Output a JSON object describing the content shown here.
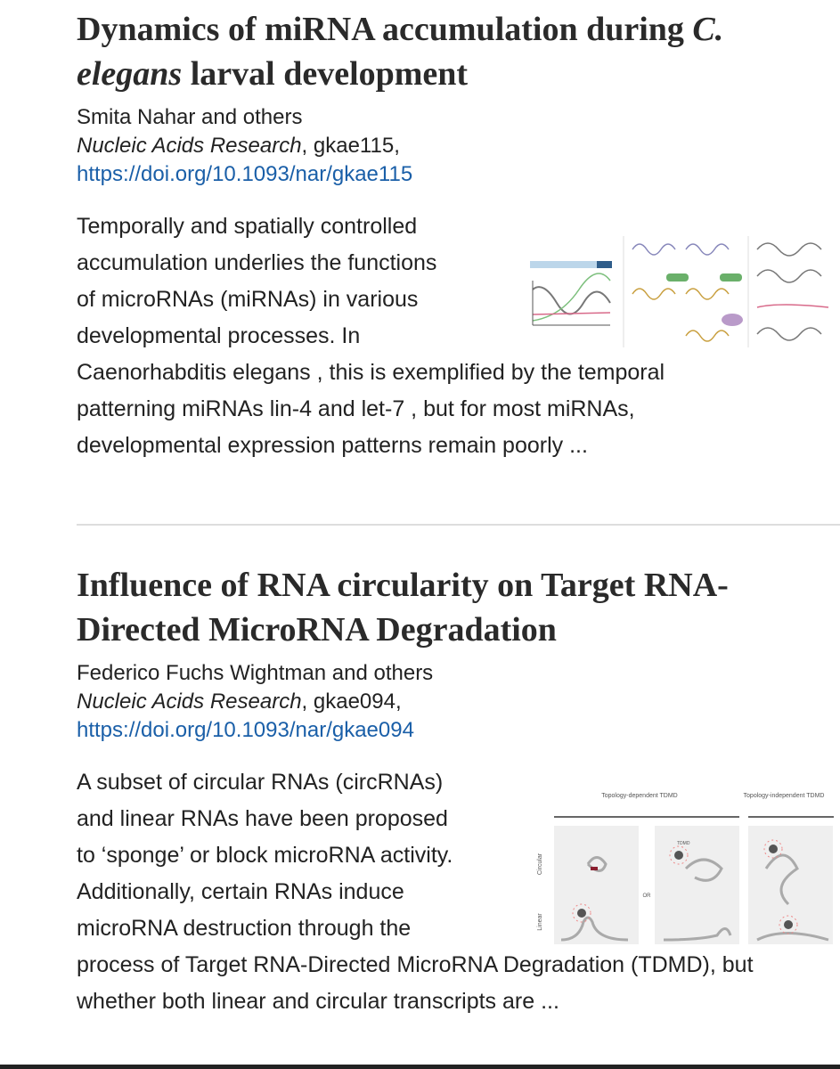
{
  "articles": [
    {
      "title_lines": [
        "Dynamics of miRNA accumulation during C.",
        "elegans larval development"
      ],
      "title_italic_parts": [
        "C.",
        "elegans"
      ],
      "authors": "Smita Nahar and others",
      "journal": "Nucleic Acids Research",
      "article_id": ", gkae115,",
      "doi": "https://doi.org/10.1093/nar/gkae115",
      "abstract_lines": [
        "Temporally and spatially controlled",
        "accumulation underlies the functions",
        "of microRNAs (miRNAs) in various",
        "developmental processes. In",
        "Caenorhabditis elegans , this is exemplified by the temporal",
        "patterning miRNAs lin-4 and let-7 , but for most miRNAs,",
        "developmental expression patterns remain poorly ..."
      ]
    },
    {
      "title_lines": [
        "Influence of RNA circularity on Target RNA-",
        "Directed MicroRNA Degradation"
      ],
      "authors": "Federico Fuchs Wightman and others",
      "journal": "Nucleic Acids Research",
      "article_id": ", gkae094,",
      "doi": "https://doi.org/10.1093/nar/gkae094",
      "abstract_lines": [
        "A subset of circular RNAs (circRNAs)",
        "and linear RNAs have been proposed",
        "to ‘sponge’ or block microRNA activity.",
        "Additionally, certain RNAs induce",
        "microRNA destruction through the",
        "process of Target RNA-Directed MicroRNA Degradation (TDMD), but",
        "whether both linear and circular transcripts are ..."
      ],
      "figure": {
        "header_left": "Topology-dependent TDMD",
        "header_right": "Topology-independent TDMD",
        "row_circular": "Circular",
        "row_linear": "Linear",
        "or_label": "OR",
        "tdmd_label": "TDMD"
      }
    }
  ],
  "colors": {
    "link": "#1a5fa8",
    "text": "#222222"
  }
}
